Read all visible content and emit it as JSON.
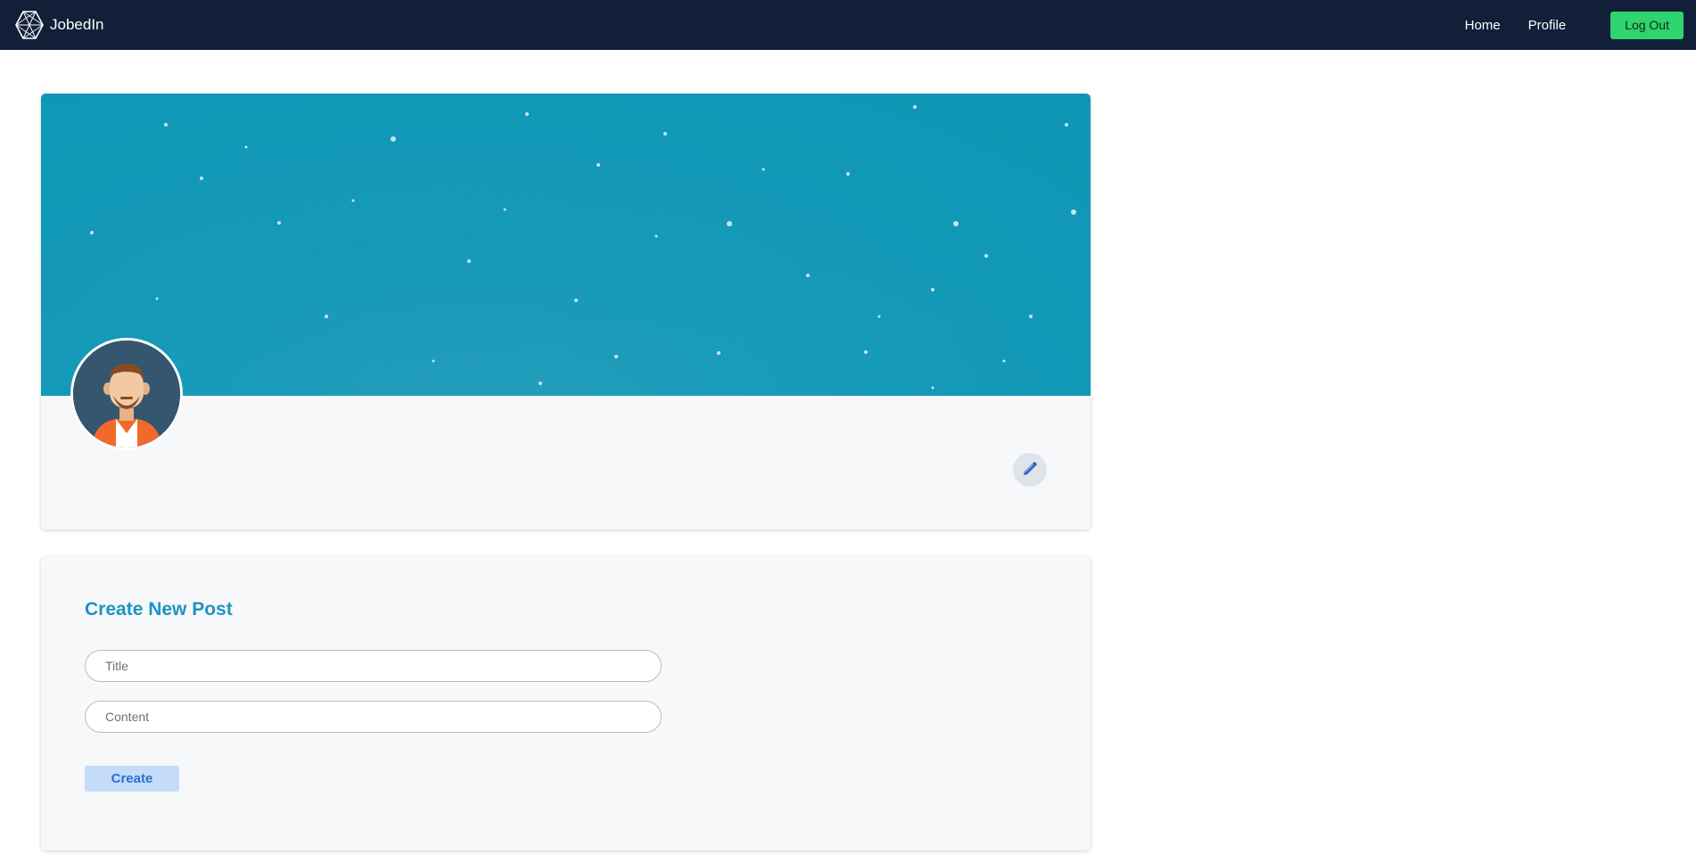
{
  "navbar": {
    "brand_name": "JobedIn",
    "links": [
      {
        "label": "Home"
      },
      {
        "label": "Profile"
      }
    ],
    "logout_label": "Log Out",
    "colors": {
      "background": "#111f38",
      "logout_button": "#2fd46e"
    }
  },
  "profile": {
    "cover_color": "#1499b8",
    "avatar_icon": "user-avatar-illustration",
    "edit_icon": "pencil-icon"
  },
  "create_post": {
    "heading": "Create New Post",
    "title_input": {
      "placeholder": "Title",
      "value": ""
    },
    "content_input": {
      "placeholder": "Content",
      "value": ""
    },
    "create_label": "Create",
    "colors": {
      "heading": "#1e93c4",
      "button_bg": "#c4dcf7",
      "button_text": "#2b6fd6"
    }
  }
}
